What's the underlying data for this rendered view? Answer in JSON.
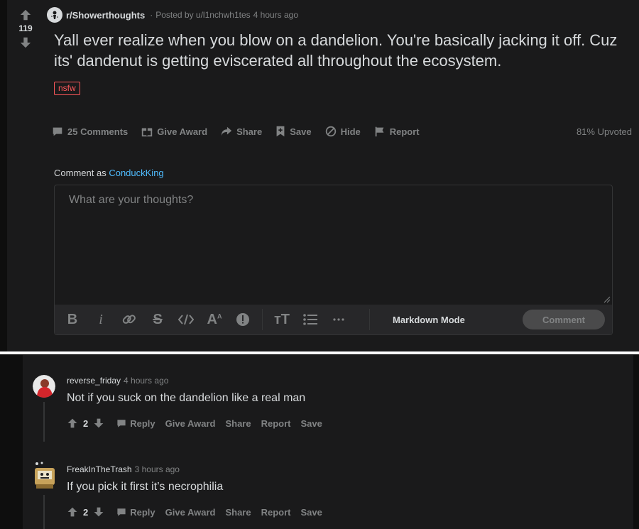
{
  "post": {
    "vote_count": "119",
    "subreddit": "r/Showerthoughts",
    "posted_by": "Posted by u/l1nchwh1tes",
    "posted_time": "4 hours ago",
    "title": "Yall ever realize when you blow on a dandelion. You're basically jacking it off. Cuz its' dandenut is getting eviscerated all throughout the ecosystem.",
    "flair": "nsfw",
    "actions": {
      "comments": "25 Comments",
      "give_award": "Give Award",
      "share": "Share",
      "save": "Save",
      "hide": "Hide",
      "report": "Report"
    },
    "upvoted": "81% Upvoted"
  },
  "composer": {
    "comment_as_label": "Comment as",
    "username": "ConduckKing",
    "placeholder": "What are your thoughts?",
    "markdown_mode": "Markdown Mode",
    "comment_button": "Comment"
  },
  "comments": [
    {
      "author": "reverse_friday",
      "time": "4 hours ago",
      "body": "Not if you suck on the dandelion like a real man",
      "score": "2",
      "actions": {
        "reply": "Reply",
        "give_award": "Give Award",
        "share": "Share",
        "report": "Report",
        "save": "Save"
      }
    },
    {
      "author": "FreakInTheTrash",
      "time": "3 hours ago",
      "body": "If you pick it first it’s necrophilia",
      "score": "2",
      "actions": {
        "reply": "Reply",
        "give_award": "Give Award",
        "share": "Share",
        "report": "Report",
        "save": "Save"
      }
    }
  ],
  "colors": {
    "background": "#1a1a1b",
    "text": "#d7dadc",
    "muted": "#818384",
    "link": "#4fbcff",
    "nsfw": "#ff585b"
  }
}
